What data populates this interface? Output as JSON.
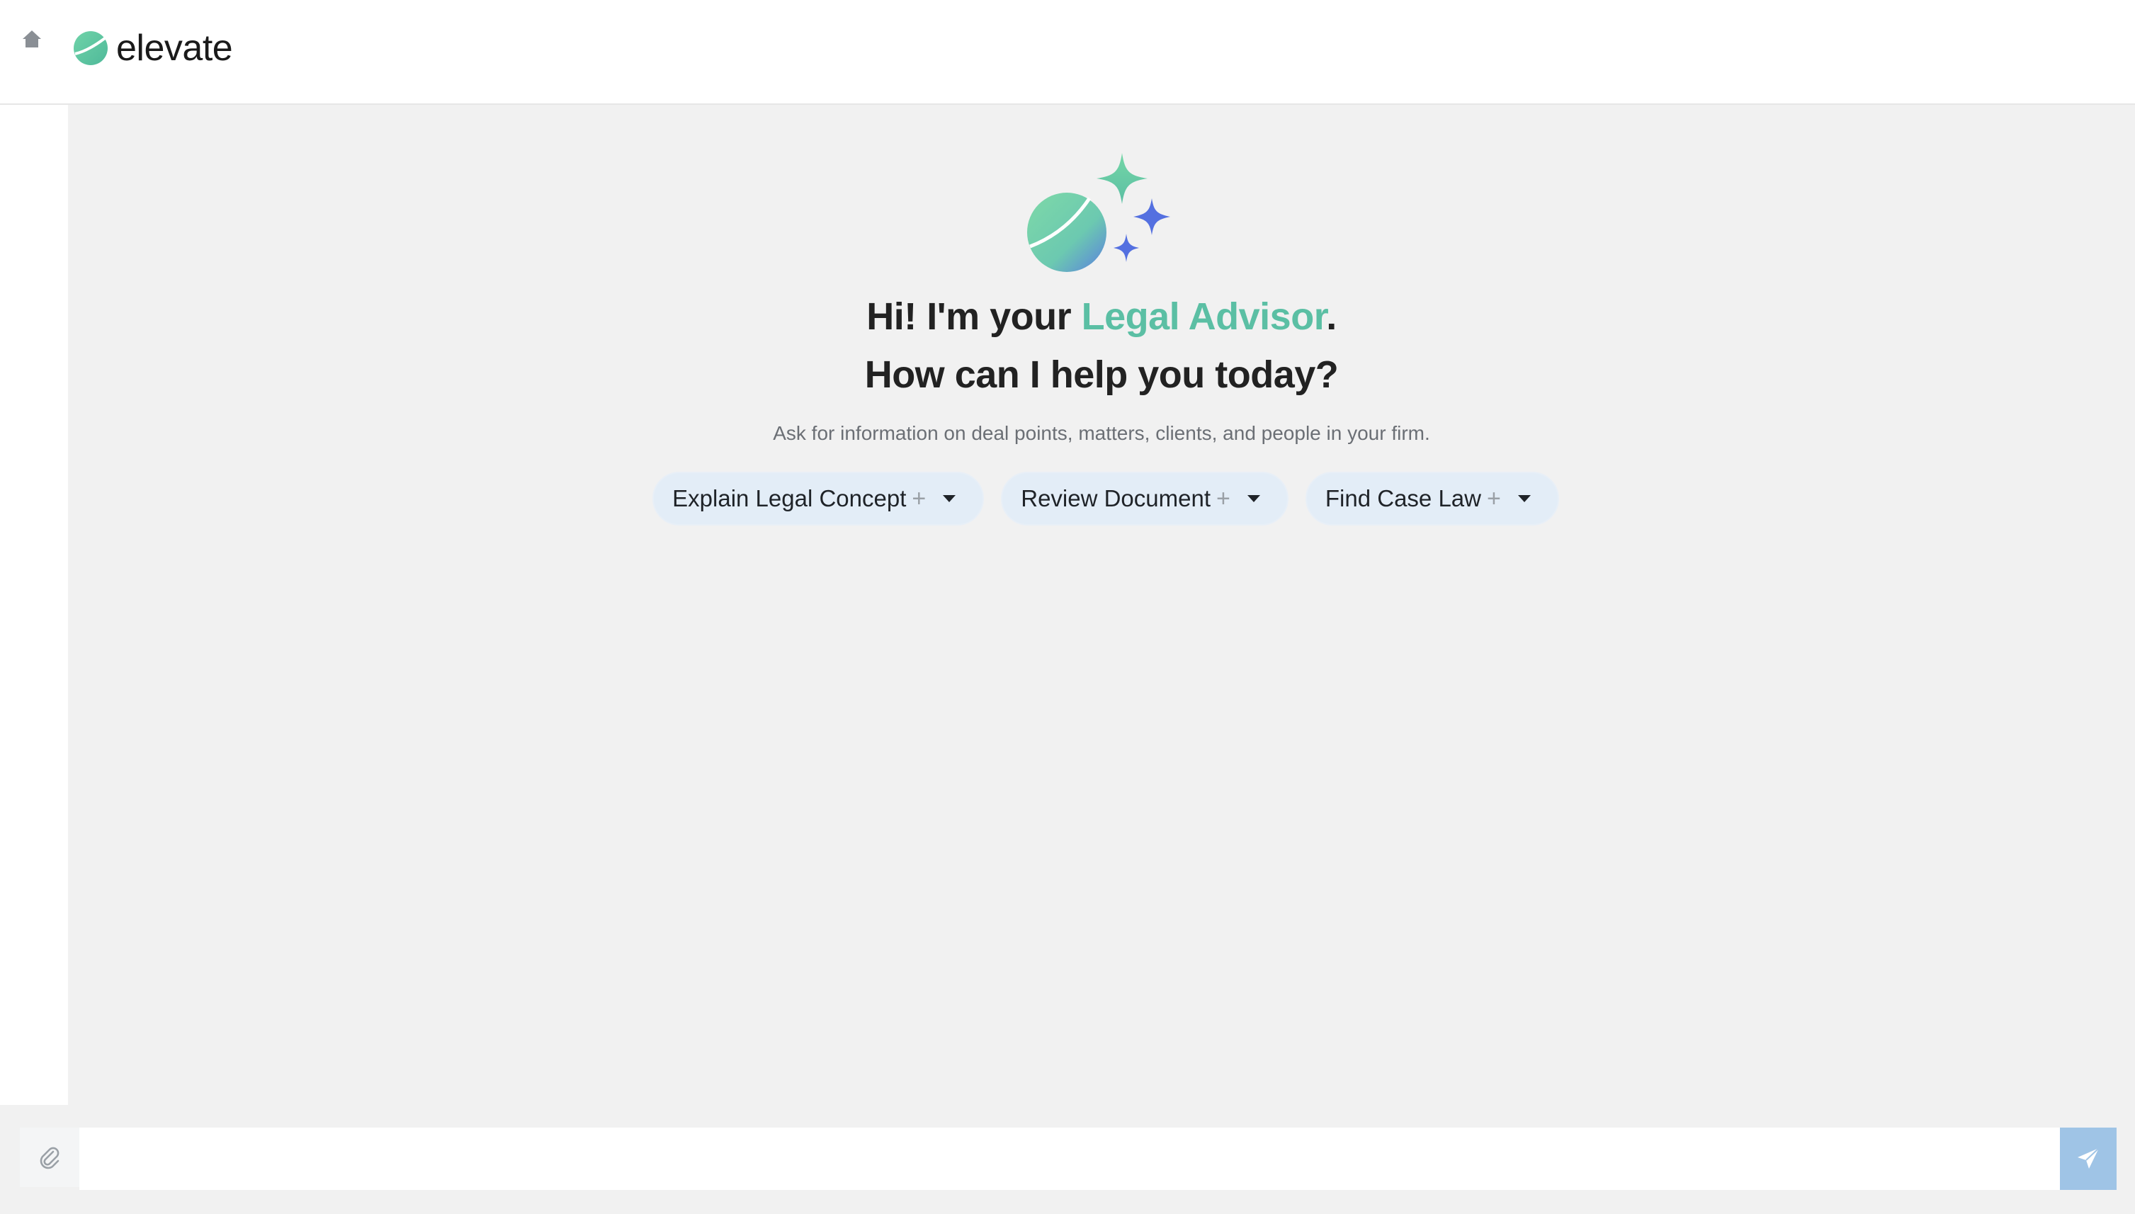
{
  "header": {
    "brand_name": "elevate",
    "home_icon": "home-icon",
    "brand_color": "#5bbfa4"
  },
  "hero": {
    "greeting_prefix": "Hi! I'm your ",
    "assistant_name": "Legal Advisor",
    "greeting_suffix": ".",
    "question": "How can I help you today?",
    "subtitle": "Ask for information on deal points, matters, clients, and people in your firm."
  },
  "prompt_chips": [
    {
      "label": "Explain Legal Concept",
      "plus": "+"
    },
    {
      "label": "Review Document",
      "plus": "+"
    },
    {
      "label": "Find Case Law",
      "plus": "+"
    }
  ],
  "input_bar": {
    "placeholder": "",
    "attach_icon": "paperclip-icon",
    "send_icon": "send-icon"
  },
  "colors": {
    "accent": "#5bbfa4",
    "chip_bg": "#e3edf7",
    "send_bg": "#9fc4e6",
    "sparkle_blue": "#5470e0"
  }
}
